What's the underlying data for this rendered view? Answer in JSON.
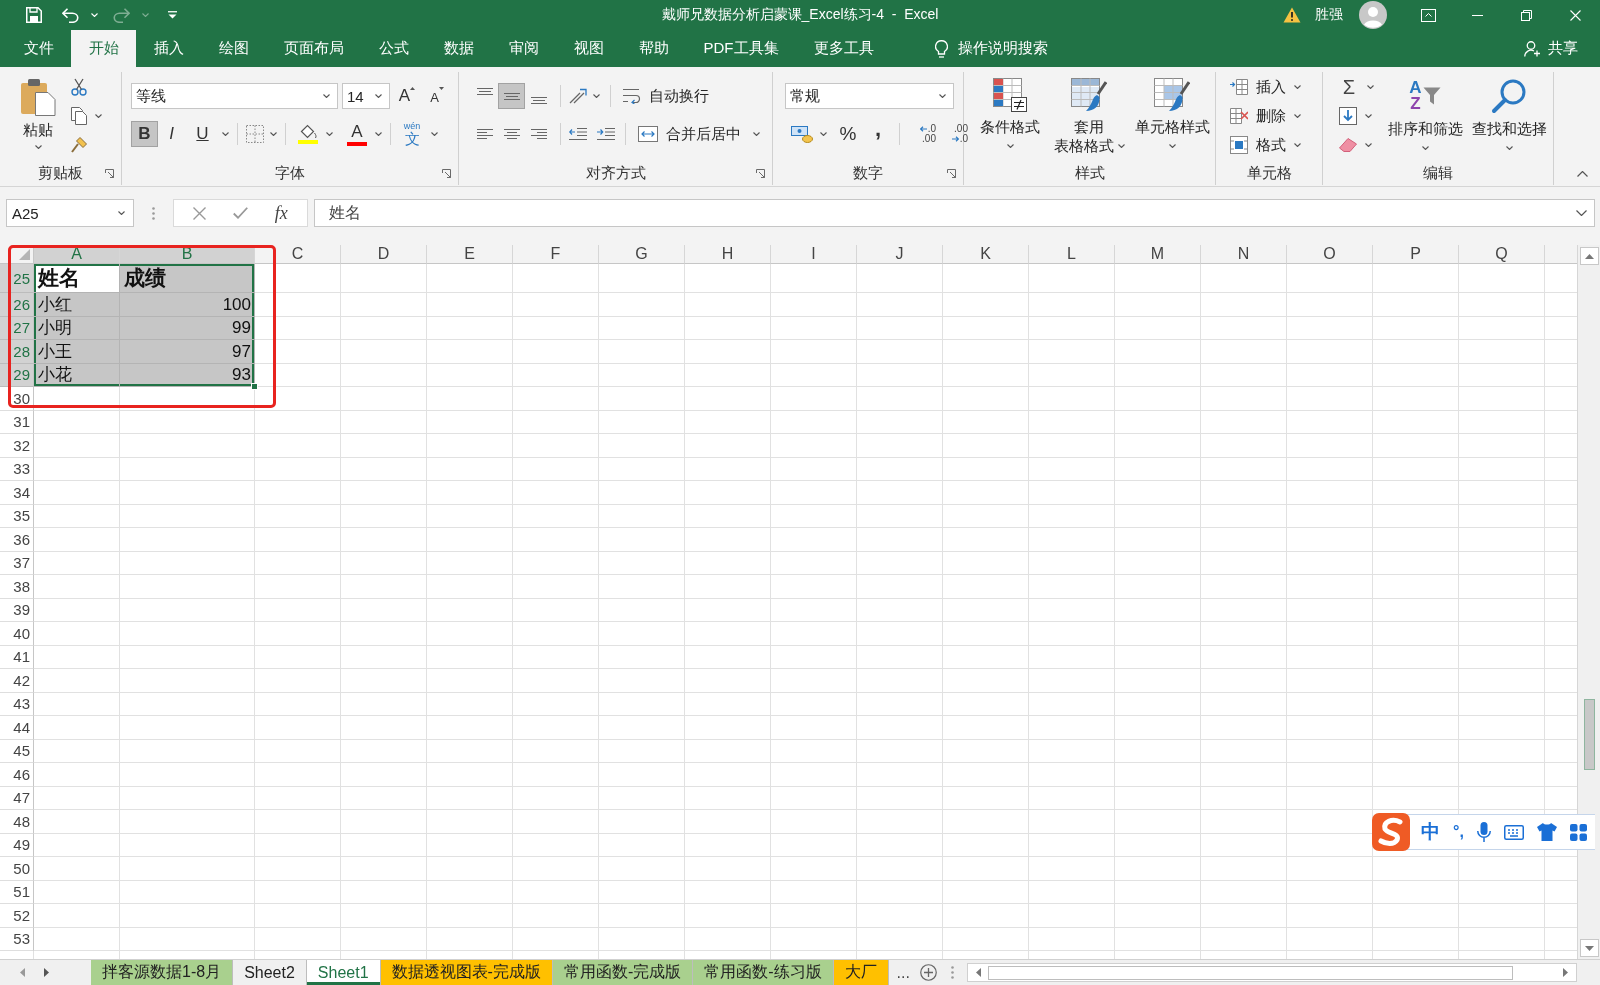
{
  "quick_access": [
    {
      "kind": "save",
      "disabled": false
    },
    {
      "kind": "undo",
      "disabled": false
    },
    {
      "kind": "redo",
      "disabled": true
    },
    {
      "kind": "customize",
      "disabled": false
    }
  ],
  "window": {
    "title": "戴师兄数据分析启蒙课_Excel练习-4  -  Excel",
    "user": "胜强"
  },
  "menu_tabs": [
    {
      "label": "文件",
      "selected": false
    },
    {
      "label": "开始",
      "selected": true
    },
    {
      "label": "插入",
      "selected": false
    },
    {
      "label": "绘图",
      "selected": false
    },
    {
      "label": "页面布局",
      "selected": false
    },
    {
      "label": "公式",
      "selected": false
    },
    {
      "label": "数据",
      "selected": false
    },
    {
      "label": "审阅",
      "selected": false
    },
    {
      "label": "视图",
      "selected": false
    },
    {
      "label": "帮助",
      "selected": false
    },
    {
      "label": "PDF工具集",
      "selected": false
    },
    {
      "label": "更多工具",
      "selected": false
    }
  ],
  "tell_me": "操作说明搜索",
  "share": "共享",
  "ribbon": {
    "clipboard": {
      "label": "剪贴板",
      "paste": "粘贴"
    },
    "font": {
      "label": "字体",
      "font_name": "等线",
      "font_size": "14",
      "size_steps": [
        {
          "kind": "grow",
          "glyph": "A"
        },
        {
          "kind": "shrink",
          "glyph": "A"
        }
      ],
      "styles": [
        {
          "kind": "bold",
          "glyph": "B",
          "on": true
        },
        {
          "kind": "italic",
          "glyph": "I",
          "on": false
        },
        {
          "kind": "underline",
          "glyph": "U",
          "on": false
        }
      ],
      "colors": [
        {
          "kind": "fill",
          "color": "#ffff00"
        },
        {
          "kind": "font",
          "glyph": "A",
          "color": "#ff0000"
        }
      ],
      "phonetic": {
        "ruby": "wén",
        "glyph": "文"
      }
    },
    "alignment": {
      "label": "对齐方式",
      "vertical": [
        {
          "kind": "top",
          "on": false
        },
        {
          "kind": "middle",
          "on": true
        },
        {
          "kind": "bottom",
          "on": false
        }
      ],
      "horizontal": [
        {
          "kind": "left",
          "on": false
        },
        {
          "kind": "center",
          "on": false
        },
        {
          "kind": "right",
          "on": false
        }
      ],
      "wrap_text": "自动换行",
      "merge_center": "合并后居中"
    },
    "number": {
      "label": "数字",
      "format": "常规",
      "tools": [
        {
          "kind": "accounting"
        },
        {
          "kind": "percent",
          "glyph": "%"
        },
        {
          "kind": "comma",
          "glyph": ","
        },
        {
          "kind": "increase_decimal",
          "lines": [
            ".0",
            ".00"
          ]
        },
        {
          "kind": "decrease_decimal",
          "lines": [
            ".00",
            ".0"
          ]
        }
      ]
    },
    "styles": {
      "label": "样式",
      "commands": [
        {
          "kind": "conditional",
          "lines": [
            "条件格式"
          ]
        },
        {
          "kind": "table",
          "lines": [
            "套用",
            "表格格式"
          ]
        },
        {
          "kind": "cell_styles",
          "lines": [
            "单元格样式"
          ]
        }
      ]
    },
    "cells": {
      "label": "单元格",
      "commands": [
        {
          "kind": "insert",
          "text": "插入"
        },
        {
          "kind": "delete",
          "text": "删除"
        },
        {
          "kind": "format",
          "text": "格式"
        }
      ]
    },
    "editing": {
      "label": "编辑",
      "small": [
        {
          "kind": "autosum",
          "glyph": "Σ"
        },
        {
          "kind": "fill"
        },
        {
          "kind": "clear"
        }
      ],
      "commands": [
        {
          "kind": "sort",
          "lines": [
            "排序和筛选"
          ],
          "letters": [
            "A",
            "Z"
          ]
        },
        {
          "kind": "find",
          "lines": [
            "查找和选择"
          ]
        }
      ]
    }
  },
  "formula_bar": {
    "name_box": "A25",
    "function_label": "fx",
    "formula": "姓名"
  },
  "sheet": {
    "columns": [
      {
        "label": "A",
        "selected": true
      },
      {
        "label": "B",
        "selected": true
      },
      {
        "label": "C",
        "selected": false
      },
      {
        "label": "D",
        "selected": false
      },
      {
        "label": "E",
        "selected": false
      },
      {
        "label": "F",
        "selected": false
      },
      {
        "label": "G",
        "selected": false
      },
      {
        "label": "H",
        "selected": false
      },
      {
        "label": "I",
        "selected": false
      },
      {
        "label": "J",
        "selected": false
      },
      {
        "label": "K",
        "selected": false
      },
      {
        "label": "L",
        "selected": false
      },
      {
        "label": "M",
        "selected": false
      },
      {
        "label": "N",
        "selected": false
      },
      {
        "label": "O",
        "selected": false
      },
      {
        "label": "P",
        "selected": false
      },
      {
        "label": "Q",
        "selected": false
      }
    ],
    "rows": [
      {
        "number": "25",
        "selected": true,
        "kind": "heading",
        "cells": [
          {
            "kind": "text",
            "value": "姓名",
            "selected": true,
            "active": true
          },
          {
            "kind": "text",
            "value": "成绩",
            "selected": true,
            "active": false
          }
        ]
      },
      {
        "number": "26",
        "selected": true,
        "kind": "data",
        "cells": [
          {
            "kind": "text",
            "value": "小红",
            "selected": true,
            "active": false
          },
          {
            "kind": "number",
            "value": "100",
            "selected": true,
            "active": false
          }
        ]
      },
      {
        "number": "27",
        "selected": true,
        "kind": "data",
        "cells": [
          {
            "kind": "text",
            "value": "小明",
            "selected": true,
            "active": false
          },
          {
            "kind": "number",
            "value": "99",
            "selected": true,
            "active": false
          }
        ]
      },
      {
        "number": "28",
        "selected": true,
        "kind": "data",
        "cells": [
          {
            "kind": "text",
            "value": "小王",
            "selected": true,
            "active": false
          },
          {
            "kind": "number",
            "value": "97",
            "selected": true,
            "active": false
          }
        ]
      },
      {
        "number": "29",
        "selected": true,
        "kind": "data",
        "cells": [
          {
            "kind": "text",
            "value": "小花",
            "selected": true,
            "active": false
          },
          {
            "kind": "number",
            "value": "93",
            "selected": true,
            "active": false
          }
        ]
      },
      {
        "number": "30",
        "selected": false,
        "kind": "data"
      },
      {
        "number": "31",
        "selected": false,
        "kind": "data"
      },
      {
        "number": "32",
        "selected": false,
        "kind": "data"
      },
      {
        "number": "33",
        "selected": false,
        "kind": "data"
      },
      {
        "number": "34",
        "selected": false,
        "kind": "data"
      },
      {
        "number": "35",
        "selected": false,
        "kind": "data"
      },
      {
        "number": "36",
        "selected": false,
        "kind": "data"
      },
      {
        "number": "37",
        "selected": false,
        "kind": "data"
      },
      {
        "number": "38",
        "selected": false,
        "kind": "data"
      },
      {
        "number": "39",
        "selected": false,
        "kind": "data"
      },
      {
        "number": "40",
        "selected": false,
        "kind": "data"
      },
      {
        "number": "41",
        "selected": false,
        "kind": "data"
      },
      {
        "number": "42",
        "selected": false,
        "kind": "data"
      },
      {
        "number": "43",
        "selected": false,
        "kind": "data"
      },
      {
        "number": "44",
        "selected": false,
        "kind": "data"
      },
      {
        "number": "45",
        "selected": false,
        "kind": "data"
      },
      {
        "number": "46",
        "selected": false,
        "kind": "data"
      },
      {
        "number": "47",
        "selected": false,
        "kind": "data"
      },
      {
        "number": "48",
        "selected": false,
        "kind": "data"
      },
      {
        "number": "49",
        "selected": false,
        "kind": "data"
      },
      {
        "number": "50",
        "selected": false,
        "kind": "data"
      },
      {
        "number": "51",
        "selected": false,
        "kind": "data"
      },
      {
        "number": "52",
        "selected": false,
        "kind": "data"
      },
      {
        "number": "53",
        "selected": false,
        "kind": "data"
      }
    ]
  },
  "annotation": {
    "kind": "frame"
  },
  "sheet_tabs": {
    "tabs": [
      {
        "label": "拌客源数据1-8月",
        "selected": false,
        "color": "#a9d08e"
      },
      {
        "label": "Sheet2",
        "selected": false
      },
      {
        "label": "Sheet1",
        "selected": true
      },
      {
        "label": "数据透视图表-完成版",
        "selected": false,
        "color": "#ffc000"
      },
      {
        "label": "常用函数-完成版",
        "selected": false,
        "color": "#a9d08e"
      },
      {
        "label": "常用函数-练习版",
        "selected": false,
        "color": "#a9d08e"
      },
      {
        "label": "大厂",
        "selected": false,
        "color": "#ffc000"
      }
    ],
    "more": "..."
  },
  "ime_toolbar": {
    "mode": "中",
    "punctuation": "°,"
  }
}
